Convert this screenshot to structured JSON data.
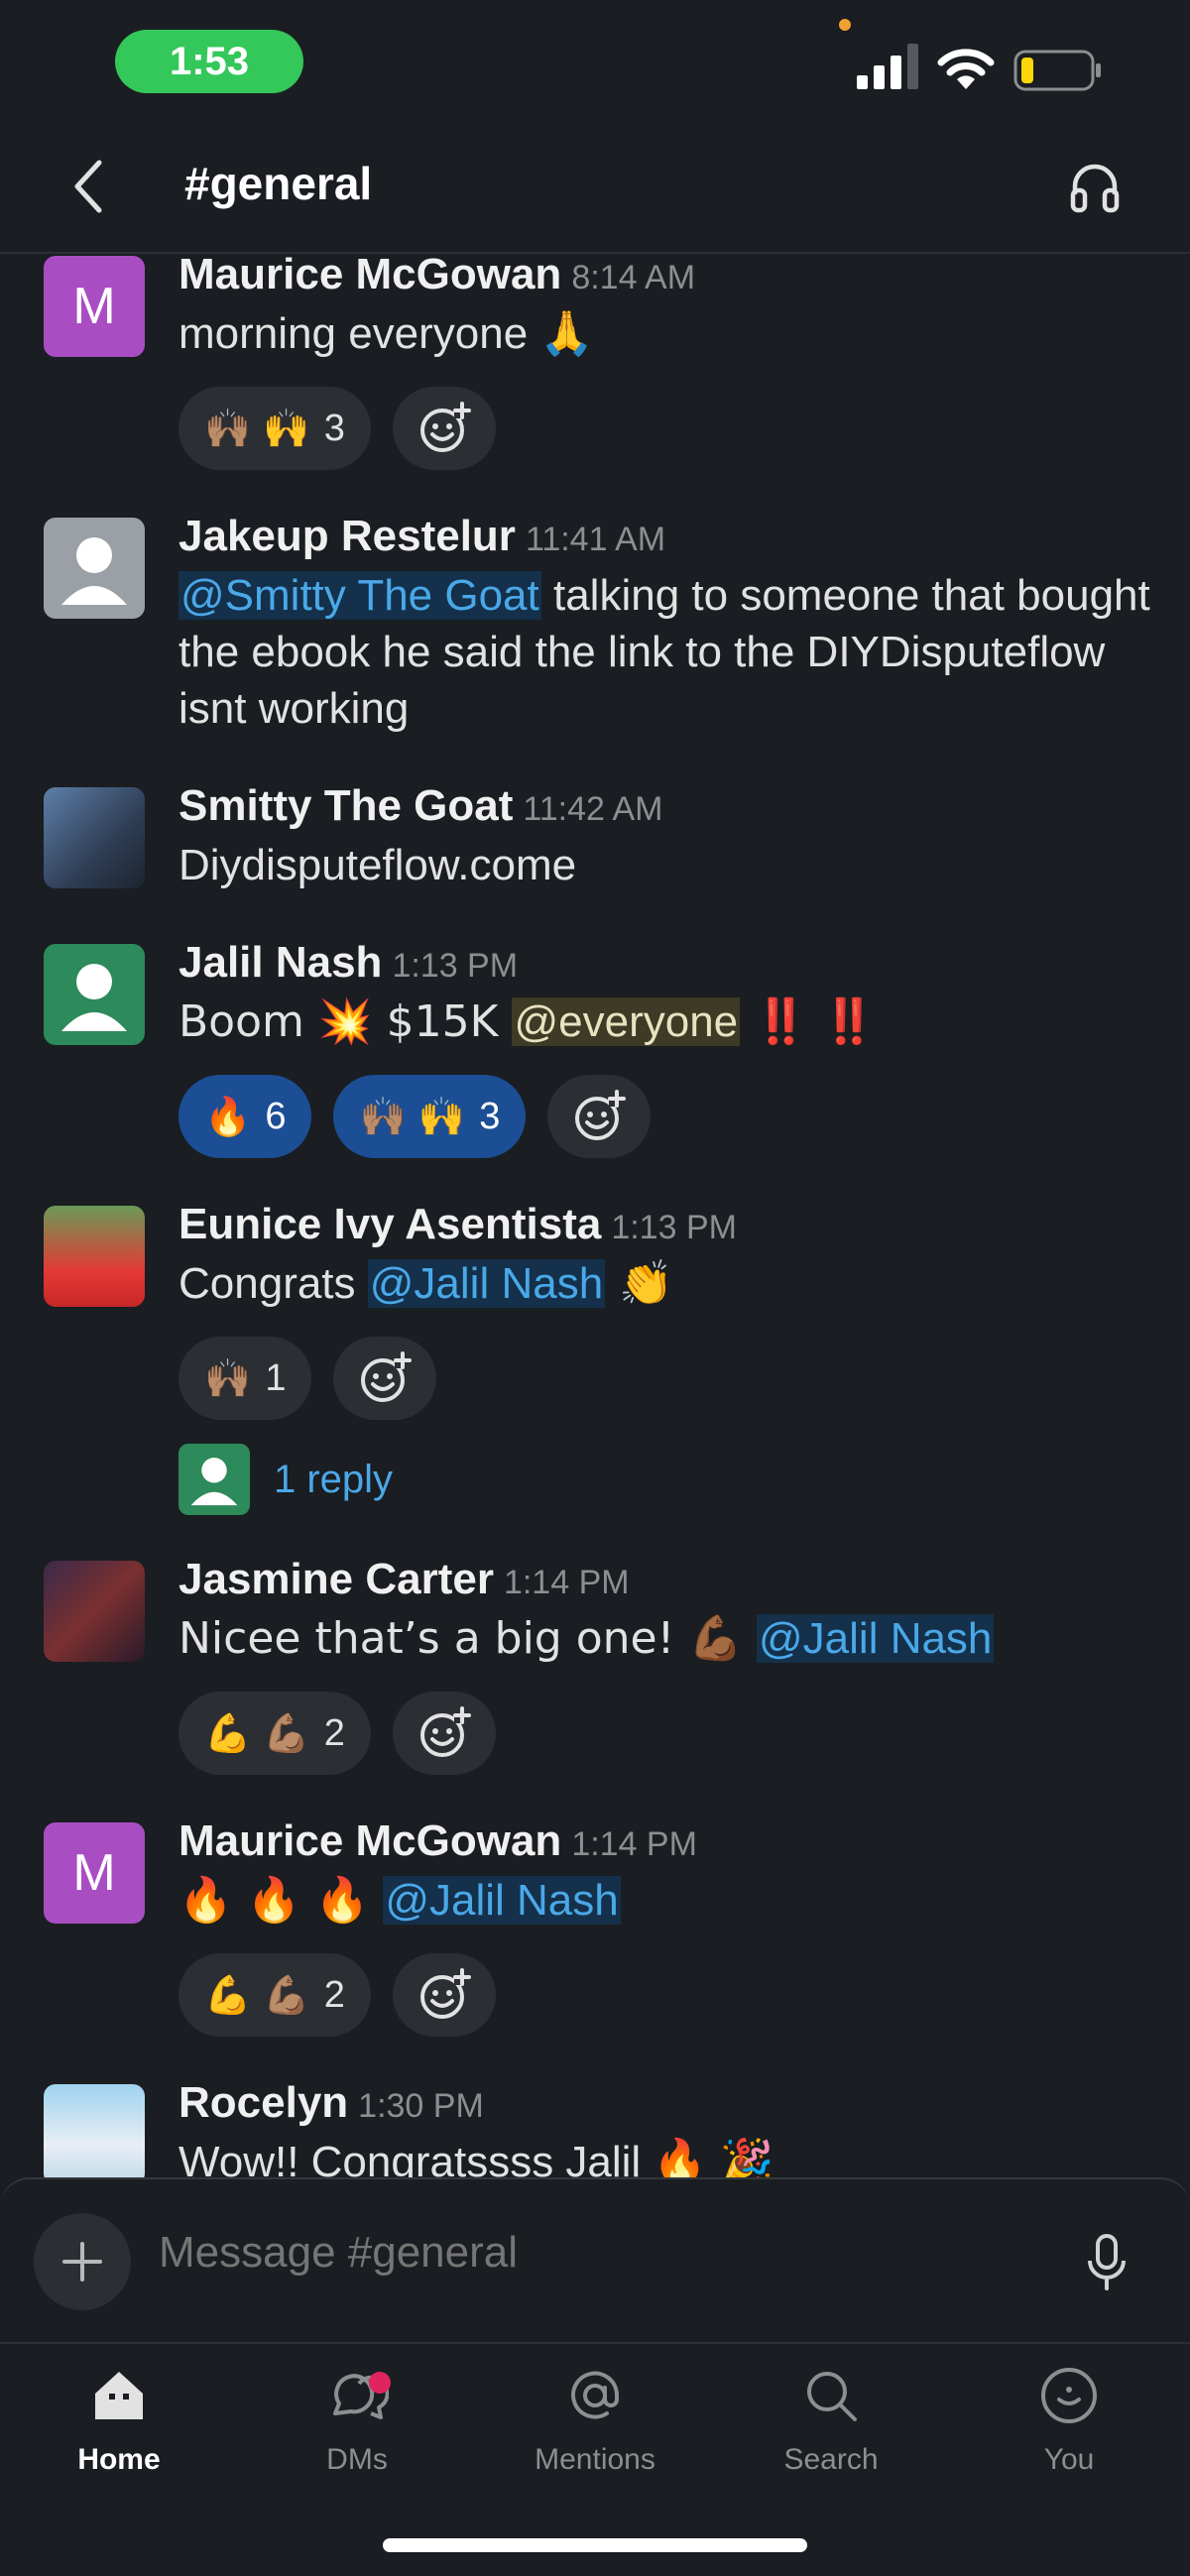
{
  "status_bar": {
    "time": "1:53"
  },
  "header": {
    "channel": "#general",
    "back_icon": "chevron-left-icon",
    "huddle_icon": "headphones-icon"
  },
  "messages": [
    {
      "author": "Maurice McGowan",
      "time": "8:14 AM",
      "avatar_letter": "M",
      "text": "morning everyone 🙏",
      "reactions": [
        {
          "emoji": "🙌🏽 🙌",
          "count": "3"
        }
      ]
    },
    {
      "author": "Jakeup Restelur",
      "time": "11:41 AM",
      "mention": "@Smitty The Goat",
      "text": " talking to someone that bought the ebook he said the link to the DIYDisputeflow isnt working"
    },
    {
      "author": "Smitty The Goat",
      "time": "11:42 AM",
      "text": "Diydisputeflow.come"
    },
    {
      "author": "Jalil Nash",
      "time": "1:13 PM",
      "text_before": "Boom 💥 $15K ",
      "mention": "@everyone",
      "text_after": " ‼️ ‼️",
      "reactions": [
        {
          "emoji": "🔥",
          "count": "6"
        },
        {
          "emoji": "🙌🏽 🙌",
          "count": "3"
        }
      ]
    },
    {
      "author": "Eunice Ivy Asentista",
      "time": "1:13 PM",
      "text_before": "Congrats ",
      "mention": "@Jalil Nash",
      "text_after": " 👏",
      "reactions": [
        {
          "emoji": "🙌🏽",
          "count": "1"
        }
      ],
      "reply": "1 reply"
    },
    {
      "author": "Jasmine Carter",
      "time": "1:14 PM",
      "text_before": "Nicee that’s a big one! 💪🏾 ",
      "mention": "@Jalil Nash",
      "reactions": [
        {
          "emoji": "💪 💪🏽",
          "count": "2"
        }
      ]
    },
    {
      "author": "Maurice McGowan",
      "time": "1:14 PM",
      "avatar_letter": "M",
      "text_before": "🔥 🔥 🔥 ",
      "mention": "@Jalil Nash",
      "reactions": [
        {
          "emoji": "💪 💪🏽",
          "count": "2"
        }
      ]
    },
    {
      "author": "Rocelyn",
      "time": "1:30 PM",
      "text": "Wow!! Congratssss Jalil 🔥 🎉"
    }
  ],
  "composer": {
    "placeholder": "Message #general"
  },
  "tabs": [
    {
      "label": "Home",
      "icon": "home-icon"
    },
    {
      "label": "DMs",
      "icon": "dms-icon"
    },
    {
      "label": "Mentions",
      "icon": "at-icon"
    },
    {
      "label": "Search",
      "icon": "search-icon"
    },
    {
      "label": "You",
      "icon": "you-icon"
    }
  ]
}
